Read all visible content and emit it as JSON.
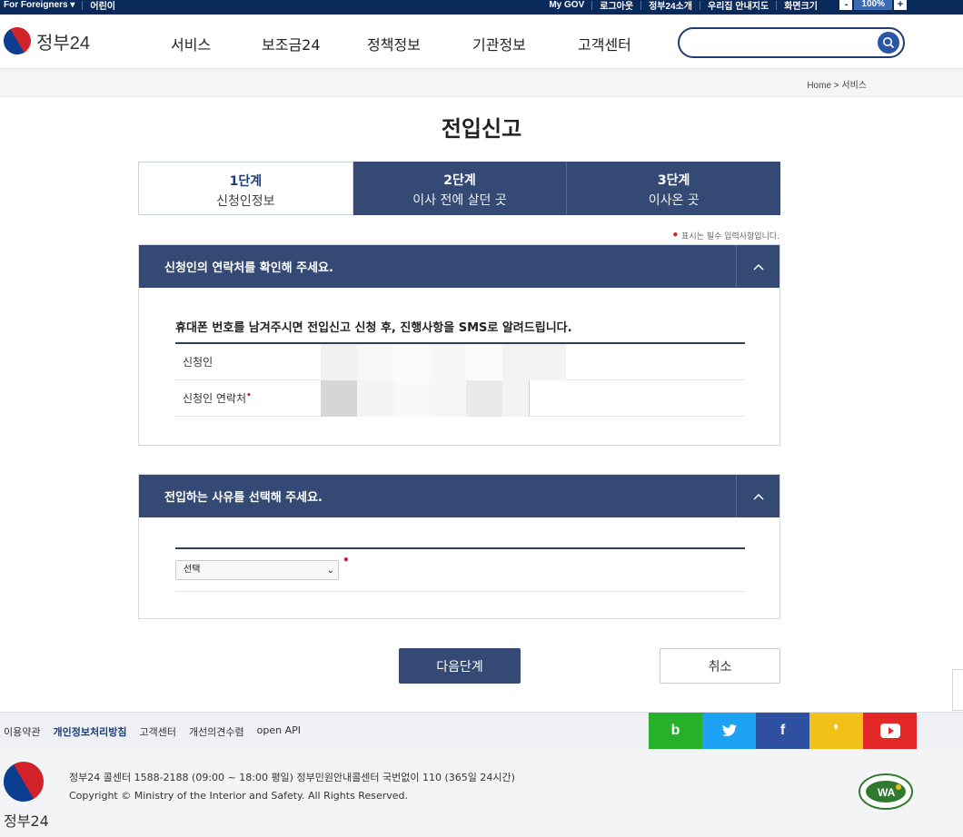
{
  "topbar": {
    "foreigners": "For Foreigners ▾",
    "kids": "어린이",
    "mygov": "My GOV",
    "logout": "로그아웃",
    "intro": "정부24소개",
    "guide": "우리집 안내지도",
    "screen_size": "화면크기",
    "zoom_minus": "-",
    "zoom_value": "100%",
    "zoom_plus": "+"
  },
  "header": {
    "logo_text": "정부24",
    "nav": [
      "서비스",
      "보조금24",
      "정책정보",
      "기관정보",
      "고객센터"
    ],
    "search_placeholder": ""
  },
  "breadcrumb": "Home > 서비스",
  "page_title": "전입신고",
  "steps": [
    {
      "num": "1단계",
      "label": "신청인정보",
      "active": true
    },
    {
      "num": "2단계",
      "label": "이사 전에 살던 곳",
      "active": false
    },
    {
      "num": "3단계",
      "label": "이사온 곳",
      "active": false
    }
  ],
  "required_note": "표시는 필수 입력사항입니다.",
  "panel1": {
    "title": "신청인의 연락처를 확인해 주세요.",
    "notice": "휴대폰 번호를 남겨주시면 전입신고 신청 후, 진행사항을 SMS로 알려드립니다.",
    "rows": [
      "신청인",
      "신청인 연락처"
    ]
  },
  "panel2": {
    "title": "전입하는 사유를 선택해 주세요.",
    "select_value": "선택"
  },
  "buttons": {
    "next": "다음단계",
    "cancel": "취소"
  },
  "footer": {
    "links": [
      "이용약관",
      "개인정보처리방침",
      "고객센터",
      "개선의견수렴",
      "open API"
    ],
    "social": [
      {
        "name": "blog",
        "label": "b",
        "color": "#27b02a"
      },
      {
        "name": "twitter",
        "label": "🐦",
        "color": "#1da1f2"
      },
      {
        "name": "facebook",
        "label": "f",
        "color": "#2f4fa0"
      },
      {
        "name": "kakao",
        "label": "❜",
        "color": "#f2c118"
      },
      {
        "name": "youtube",
        "label": "▶",
        "color": "#e32626"
      }
    ],
    "callcenter": "정부24 콜센터 1588-2188 (09:00 ~ 18:00 평일) 정부민원안내콜센터 국번없이 110 (365일 24시간)",
    "copyright": "Copyright © Ministry of the Interior and Safety. All Rights Reserved.",
    "logo_text": "정부24"
  }
}
